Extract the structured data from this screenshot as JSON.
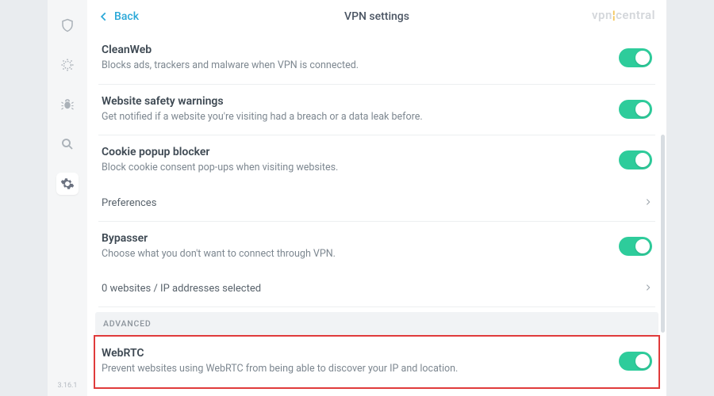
{
  "sidebar": {
    "icons": [
      "shield-icon",
      "bug-outline-icon",
      "bug-filled-icon",
      "search-icon",
      "gear-icon"
    ],
    "active_index": 4
  },
  "version": "3.16.1",
  "header": {
    "back_label": "Back",
    "title": "VPN settings",
    "brand_prefix": "vpn",
    "brand_suffix": "central"
  },
  "settings": [
    {
      "key": "cleanweb",
      "title": "CleanWeb",
      "desc": "Blocks ads, trackers and malware when VPN is connected.",
      "toggle": true
    },
    {
      "key": "safety",
      "title": "Website safety warnings",
      "desc": "Get notified if a website you're visiting had a breach or a data leak before.",
      "toggle": true
    },
    {
      "key": "cookie",
      "title": "Cookie popup blocker",
      "desc": "Block cookie consent pop-ups when visiting websites.",
      "toggle": true,
      "sub": {
        "label": "Preferences"
      }
    },
    {
      "key": "bypasser",
      "title": "Bypasser",
      "desc": "Choose what you don't want to connect through VPN.",
      "toggle": true,
      "sub": {
        "label": "0 websites / IP addresses selected"
      }
    }
  ],
  "advanced_label": "ADVANCED",
  "advanced": [
    {
      "key": "webrtc",
      "title": "WebRTC",
      "desc": "Prevent websites using WebRTC from being able to discover your IP and location.",
      "toggle": true,
      "highlighted": true
    }
  ]
}
